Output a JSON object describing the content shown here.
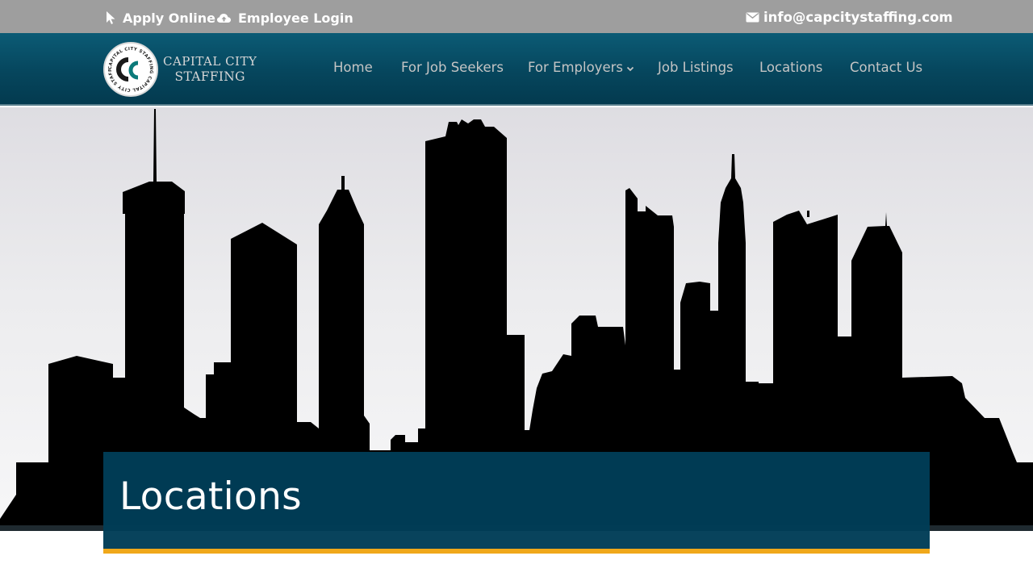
{
  "topbar": {
    "apply_label": "Apply Online",
    "login_label": "Employee Login",
    "email": "info@capcitystaffing.com"
  },
  "logo": {
    "line1": "CAPITAL CITY",
    "line2": "STAFFING",
    "ring_text": "CAPITAL CITY STAFFING CAPITAL CITY STAFFING",
    "monogram": "CC"
  },
  "nav": {
    "home": "Home",
    "seekers": "For Job Seekers",
    "employers": "For Employers",
    "listings": "Job Listings",
    "locations": "Locations",
    "contact": "Contact Us"
  },
  "page": {
    "title": "Locations"
  },
  "colors": {
    "topbar": "#9e9e9e",
    "header": "#06465d",
    "title_box": "#003d57",
    "accent": "#f0a81a"
  },
  "icons": [
    "cursor-icon",
    "cloud-upload-icon",
    "envelope-icon",
    "chevron-down-icon"
  ]
}
